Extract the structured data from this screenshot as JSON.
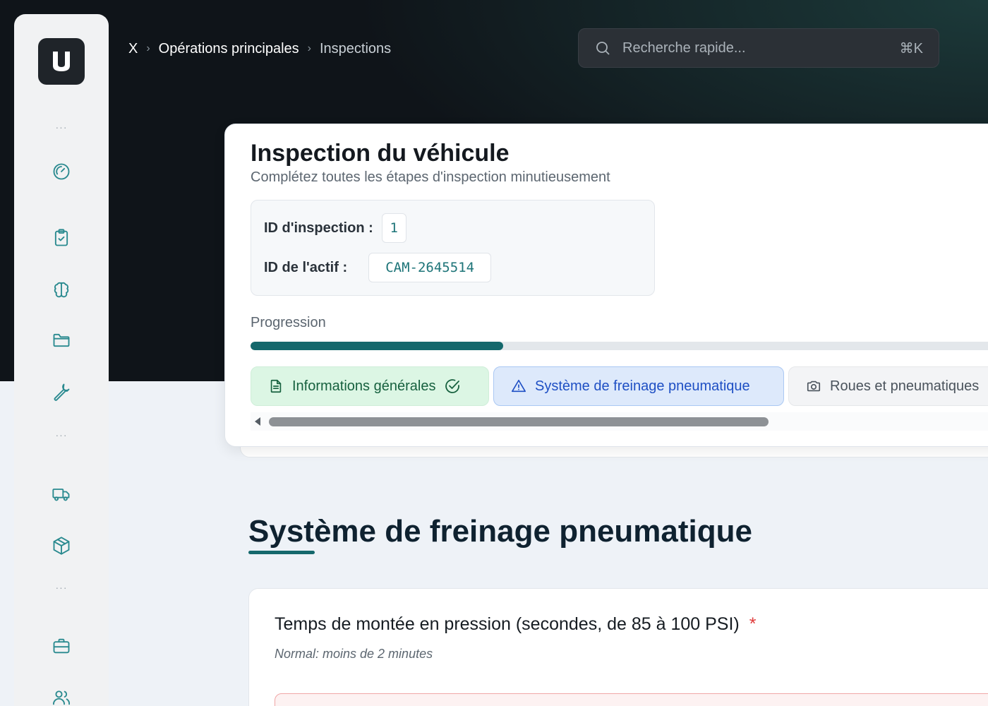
{
  "breadcrumb": {
    "home": "X",
    "section": "Opérations principales",
    "current": "Inspections",
    "separator": "›"
  },
  "search": {
    "placeholder": "Recherche rapide...",
    "shortcut": "⌘K"
  },
  "sidebar": {
    "dots": "···",
    "icons": [
      "dashboard-gauge-icon",
      "clipboard-check-icon",
      "brain-icon",
      "folder-icon",
      "wrench-icon",
      "truck-icon",
      "package-icon",
      "briefcase-icon",
      "users-icon"
    ]
  },
  "inspection": {
    "title": "Inspection du véhicule",
    "subtitle": "Complétez toutes les étapes d'inspection minutieusement",
    "inspection_id_label": "ID d'inspection :",
    "inspection_id_value": "1",
    "asset_id_label": "ID de l'actif :",
    "asset_id_value": "CAM-2645514",
    "progress_label": "Progression",
    "progress_fraction": 0.33
  },
  "tabs": [
    {
      "label": "Informations générales",
      "status": "completed",
      "icon": "document-icon"
    },
    {
      "label": "Système de freinage pneumatique",
      "status": "active",
      "icon": "warning-triangle-icon"
    },
    {
      "label": "Roues et pneumatiques",
      "status": "pending",
      "icon": "camera-icon"
    }
  ],
  "section": {
    "title": "Système de freinage pneumatique"
  },
  "field": {
    "label": "Temps de montée en pression (secondes, de 85 à 100 PSI)",
    "required_marker": "*",
    "hint": "Normal: moins de 2 minutes"
  },
  "colors": {
    "accent": "#14686c",
    "completed_tab_bg": "#dcf6e4",
    "active_tab_bg": "#dde9fb",
    "error_input_bg": "#fdf2f2",
    "required": "#e03c3c"
  }
}
